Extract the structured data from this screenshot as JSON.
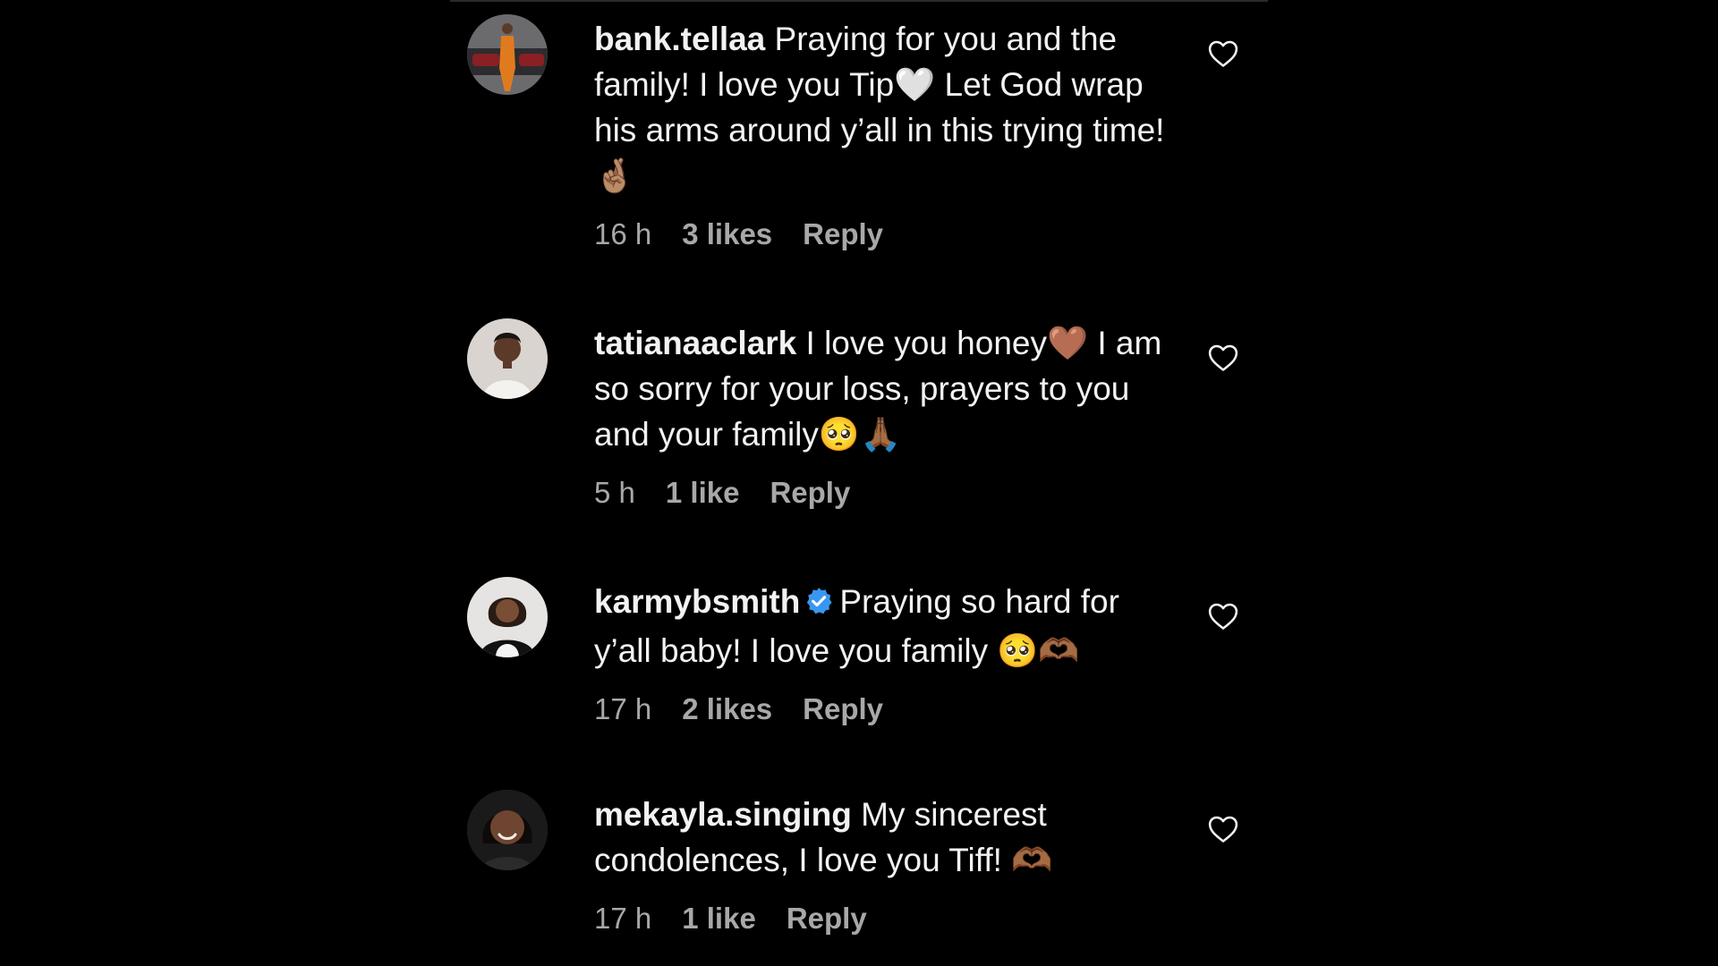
{
  "comments": [
    {
      "username": "bank.tellaa",
      "text": "Praying for you and the family! I love you Tip🤍 Let God wrap his arms around y’all in this trying time! 🤞🏽",
      "time": "16 h",
      "likes": "3 likes",
      "reply_label": "Reply",
      "verified": false,
      "avatar_icon": "avatar-photo"
    },
    {
      "username": "tatianaaclark",
      "text": "I love you honey🤎 I am so sorry for your loss, prayers to you and your family🥺🙏🏾",
      "time": "5 h",
      "likes": "1 like",
      "reply_label": "Reply",
      "verified": false,
      "avatar_icon": "avatar-photo"
    },
    {
      "username": "karmybsmith",
      "text": "Praying so hard for y’all baby! I love you family 🥺🫶🏾",
      "time": "17 h",
      "likes": "2 likes",
      "reply_label": "Reply",
      "verified": true,
      "avatar_icon": "avatar-photo"
    },
    {
      "username": "mekayla.singing",
      "text": "My sincerest condolences, I love you Tiff! 🫶🏾",
      "time": "17 h",
      "likes": "1 like",
      "reply_label": "Reply",
      "verified": false,
      "avatar_icon": "avatar-photo"
    }
  ],
  "icons": {
    "like": "heart-outline-icon",
    "verified": "verified-badge-icon"
  },
  "colors": {
    "background": "#000000",
    "text": "#f2f2f2",
    "meta": "#a8a8a8",
    "verified": "#3897f0"
  }
}
